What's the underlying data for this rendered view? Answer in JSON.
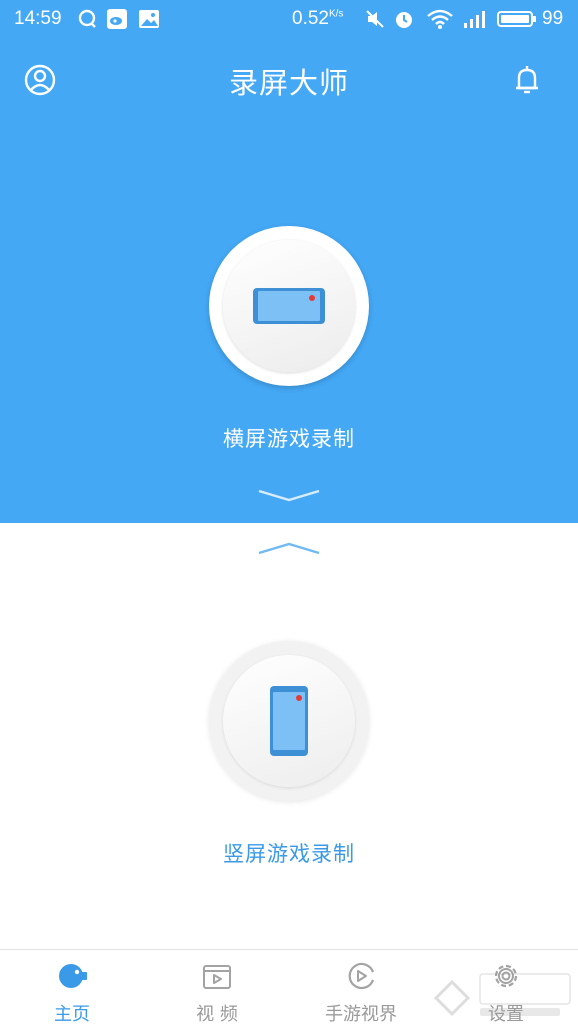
{
  "status_bar": {
    "time": "14:59",
    "speed": "0.52",
    "speed_unit": "K/s",
    "battery": "99"
  },
  "header": {
    "title": "录屏大师",
    "profile_icon": "user-circle-icon",
    "bell_icon": "bell-icon"
  },
  "landscape": {
    "label": "横屏游戏录制",
    "icon": "landscape-phone-icon"
  },
  "portrait": {
    "label": "竖屏游戏录制",
    "icon": "portrait-phone-icon"
  },
  "bottom_nav": {
    "items": [
      {
        "label": "主页",
        "icon": "home-camera-icon",
        "active": true
      },
      {
        "label": "视 频",
        "icon": "video-icon",
        "active": false
      },
      {
        "label": "手游视界",
        "icon": "game-view-icon",
        "active": false
      },
      {
        "label": "设置",
        "icon": "gear-icon",
        "active": false
      }
    ]
  },
  "colors": {
    "primary": "#44a8f5",
    "accent": "#3a9ae8",
    "record_dot": "#e53935",
    "inactive": "#9a9a9a"
  }
}
